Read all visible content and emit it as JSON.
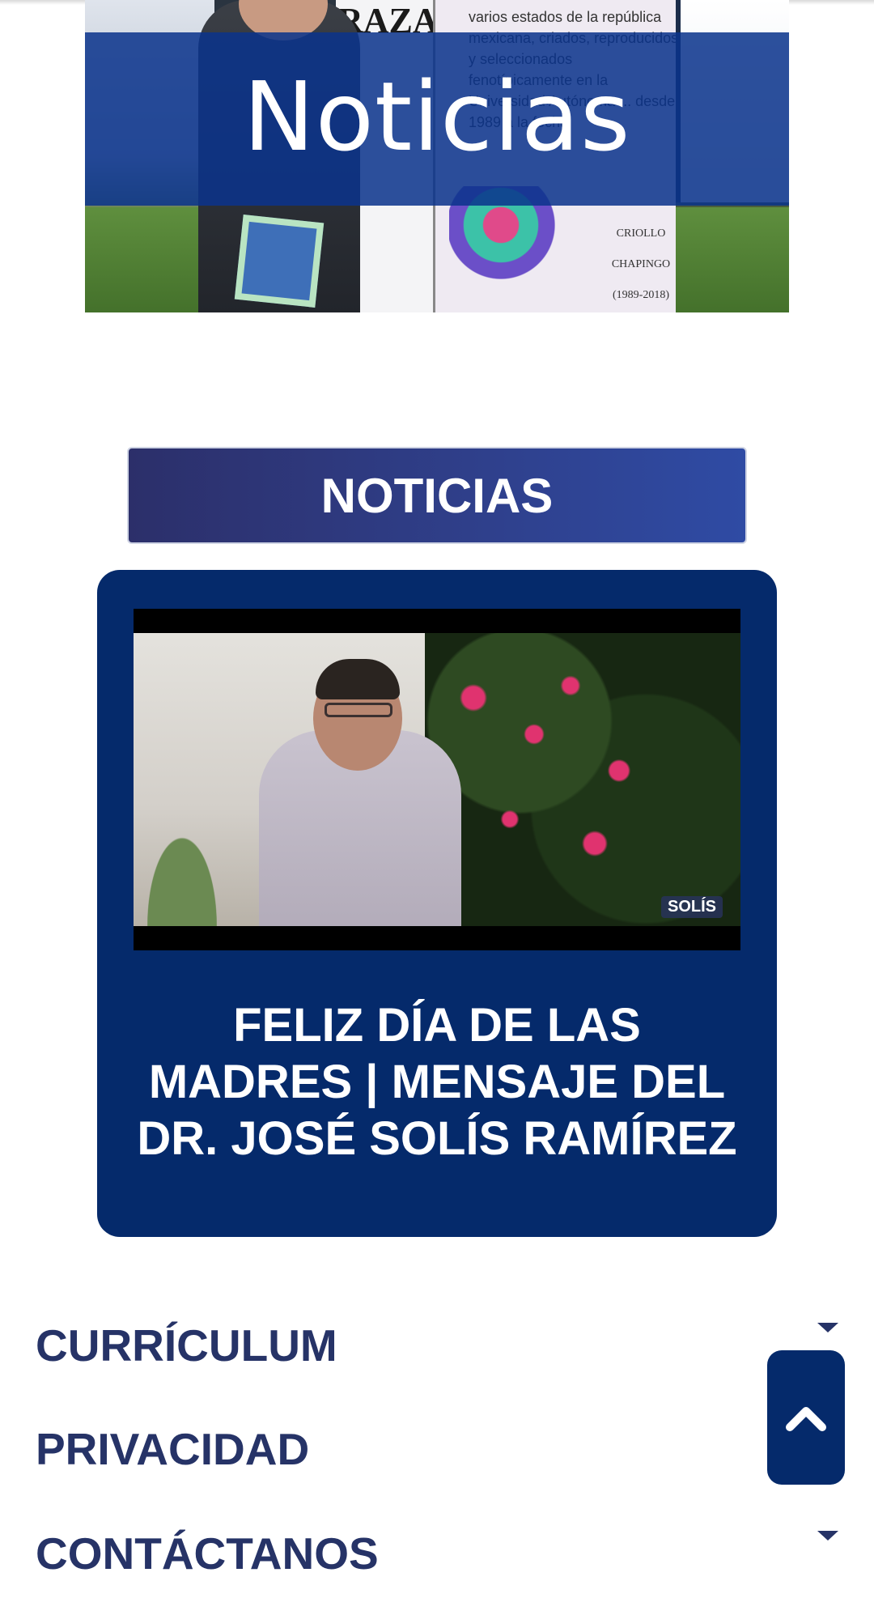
{
  "hero": {
    "title": "Noticias",
    "poster_word": "RAZA",
    "poster_text": "varios estados de la república mexicana, criados, reproducidos y seleccionados fenotípicamente en la Universidad Autónoma ... desde 1989 a la fecha",
    "poster_labels": [
      "CRIOLLO",
      "CHAPINGO",
      "(1989-2018)"
    ]
  },
  "section": {
    "button_label": "NOTICIAS"
  },
  "news": {
    "video_badge": "SOLÍS",
    "title": "FELIZ DÍA DE LAS MADRES | MENSAJE DEL DR. JOSÉ SOLÍS RAMÍREZ"
  },
  "footer": {
    "links": [
      {
        "label": "CURRÍCULUM",
        "has_dropdown": true
      },
      {
        "label": "PRIVACIDAD",
        "has_dropdown": false
      },
      {
        "label": "CONTÁCTANOS",
        "has_dropdown": true
      }
    ]
  },
  "colors": {
    "brand_navy": "#052a6b",
    "link_text": "#263367",
    "hero_band": "#0a338c"
  },
  "icons": {
    "dropdown": "caret-down-icon",
    "scroll_top": "chevron-up-icon"
  }
}
